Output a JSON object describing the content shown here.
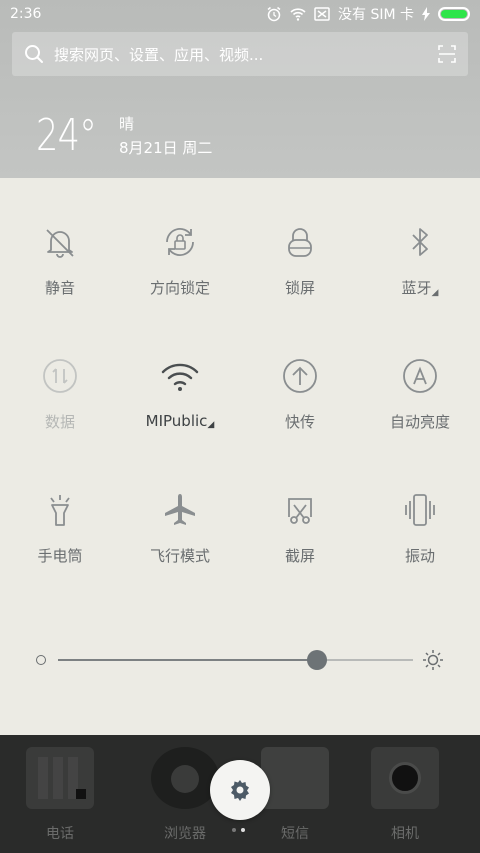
{
  "status": {
    "time": "2:36",
    "sim": "没有 SIM 卡",
    "colors": {
      "battery": "#2ee54a"
    }
  },
  "search": {
    "placeholder": "搜索网页、设置、应用、视频..."
  },
  "weather": {
    "temp": "24°",
    "condition": "晴",
    "date": "8月21日 周二"
  },
  "toggles": [
    {
      "label": "静音",
      "icon": "bell-off-icon",
      "state": "normal"
    },
    {
      "label": "方向锁定",
      "icon": "rotation-lock-icon",
      "state": "normal"
    },
    {
      "label": "锁屏",
      "icon": "lock-icon",
      "state": "normal"
    },
    {
      "label": "蓝牙",
      "icon": "bluetooth-icon",
      "state": "normal",
      "more": "◢"
    },
    {
      "label": "数据",
      "icon": "mobile-data-icon",
      "state": "disabled"
    },
    {
      "label": "MIPublic",
      "icon": "wifi-icon",
      "state": "active",
      "more": "◢"
    },
    {
      "label": "快传",
      "icon": "quick-transfer-icon",
      "state": "normal"
    },
    {
      "label": "自动亮度",
      "icon": "auto-brightness-icon",
      "state": "normal"
    },
    {
      "label": "手电筒",
      "icon": "flashlight-icon",
      "state": "normal"
    },
    {
      "label": "飞行模式",
      "icon": "airplane-icon",
      "state": "normal"
    },
    {
      "label": "截屏",
      "icon": "screenshot-icon",
      "state": "normal"
    },
    {
      "label": "振动",
      "icon": "vibrate-icon",
      "state": "normal"
    }
  ],
  "brightness": {
    "level": 0.73
  },
  "dock": {
    "apps": [
      {
        "label": "电话",
        "icon": "phone-app-icon"
      },
      {
        "label": "浏览器",
        "icon": "browser-app-icon"
      },
      {
        "label": "短信",
        "icon": "messages-app-icon"
      },
      {
        "label": "相机",
        "icon": "camera-app-icon"
      }
    ]
  },
  "pager": {
    "pages": 2,
    "current": 2
  }
}
